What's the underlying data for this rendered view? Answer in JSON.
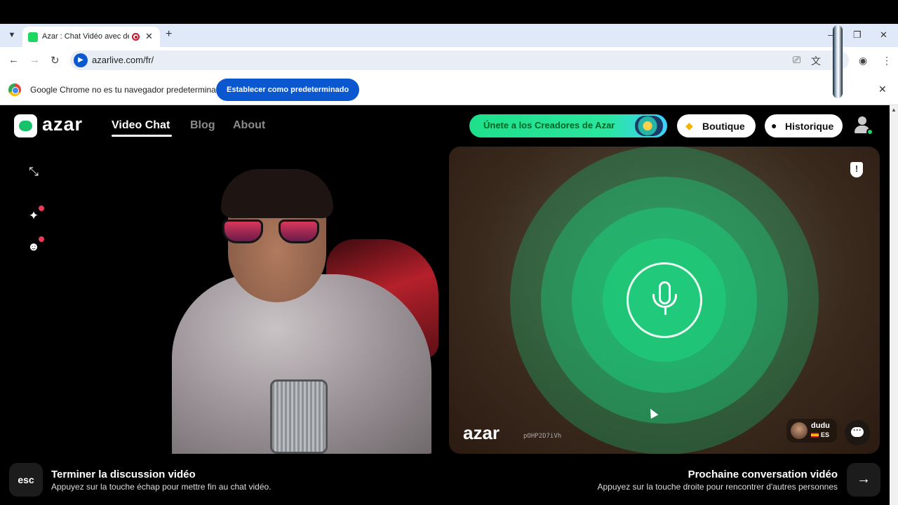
{
  "browser": {
    "tab_title": "Azar : Chat Vidéo avec de n",
    "tab_list_icon": "chevron-down-icon",
    "new_tab_symbol": "+",
    "url": "azarlive.com/fr/",
    "window_controls": [
      "–",
      "❐",
      "✕"
    ],
    "infobar": {
      "message": "Google Chrome no es tu navegador predeterminado",
      "button": "Establecer como predeterminado"
    }
  },
  "site": {
    "logo_text": "azar",
    "nav": [
      {
        "label": "Video Chat",
        "active": true
      },
      {
        "label": "Blog",
        "active": false
      },
      {
        "label": "About",
        "active": false
      }
    ],
    "creators_button": "Únete a los Creadores de Azar",
    "boutique_button": "Boutique",
    "history_button": "Historique",
    "accent_color": "#1ed760"
  },
  "video": {
    "watermark": "azar",
    "watermark_code": "pOHP2D7iVh",
    "shield_symbol": "!",
    "partner": {
      "name": "dudu",
      "language": "ES"
    }
  },
  "footer": {
    "esc_key": "esc",
    "end_title": "Terminer la discussion vidéo",
    "end_desc": "Appuyez sur la touche échap pour mettre fin au chat vidéo.",
    "next_title": "Prochaine conversation vidéo",
    "next_desc": "Appuyez sur la touche droite pour rencontrer d'autres personnes",
    "next_arrow": "→"
  }
}
